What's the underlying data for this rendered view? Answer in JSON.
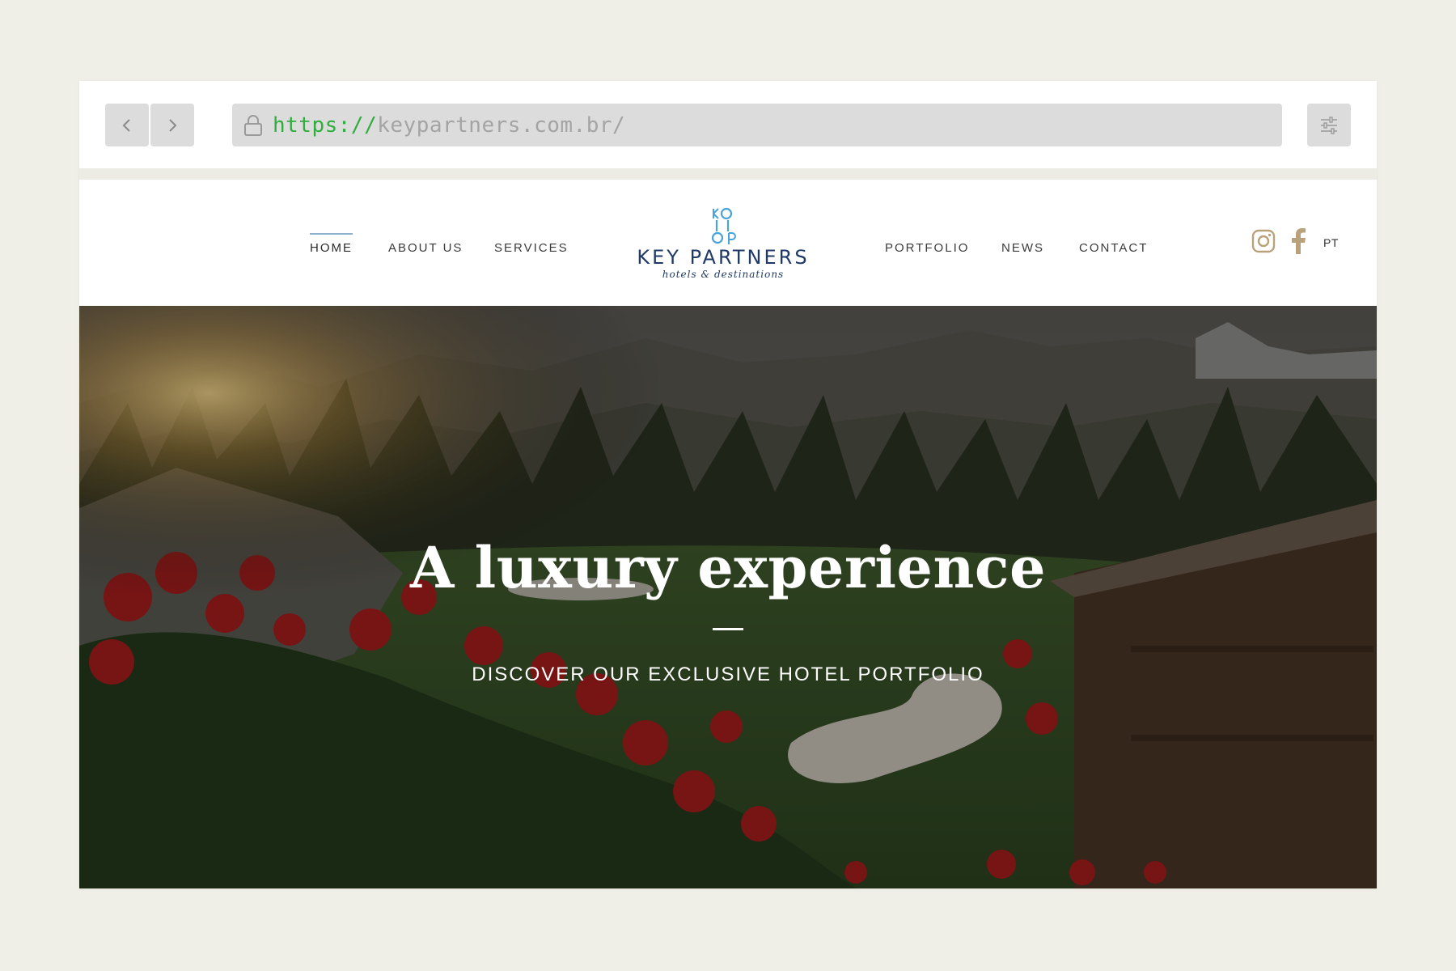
{
  "browser": {
    "url_scheme": "https://",
    "url_host": "keypartners.com.br/",
    "back_icon": "chevron-left-icon",
    "forward_icon": "chevron-right-icon",
    "lock_icon": "lock-icon",
    "menu_icon": "sliders-icon"
  },
  "nav": {
    "left": [
      "HOME",
      "ABOUT US",
      "SERVICES"
    ],
    "right": [
      "PORTFOLIO",
      "NEWS",
      "CONTACT"
    ],
    "active": "HOME"
  },
  "logo": {
    "name": "KEY PARTNERS",
    "tagline": "hotels & destinations",
    "color": "#1f3a66",
    "mark_color": "#4aa3d8"
  },
  "social": {
    "instagram_icon": "instagram-icon",
    "facebook_icon": "facebook-icon",
    "icon_color": "#b9a17c",
    "language": "PT"
  },
  "hero": {
    "title": "A luxury experience",
    "subtitle": "DISCOVER OUR EXCLUSIVE HOTEL PORTFOLIO"
  }
}
